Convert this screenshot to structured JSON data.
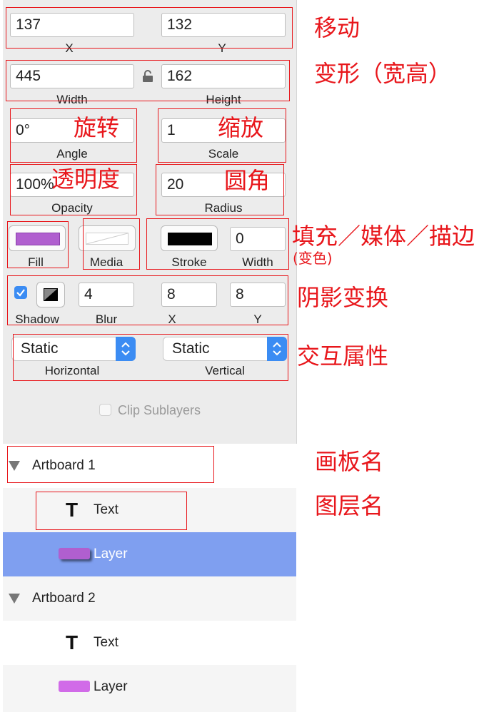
{
  "inspector": {
    "position": {
      "x_value": "137",
      "x_label": "X",
      "y_value": "132",
      "y_label": "Y"
    },
    "size": {
      "width_value": "445",
      "width_label": "Width",
      "height_value": "162",
      "height_label": "Height"
    },
    "rotation": {
      "value": "0°",
      "label": "Angle"
    },
    "scale": {
      "value": "1",
      "label": "Scale"
    },
    "opacity": {
      "value": "100%",
      "label": "Opacity"
    },
    "radius": {
      "value": "20",
      "label": "Radius"
    },
    "fill": {
      "label": "Fill",
      "color": "#b05fcf"
    },
    "media": {
      "label": "Media"
    },
    "stroke": {
      "label": "Stroke",
      "color": "#000000",
      "width_value": "0",
      "width_label": "Width"
    },
    "shadow": {
      "label": "Shadow",
      "checked": true,
      "blur_value": "4",
      "blur_label": "Blur",
      "x_value": "8",
      "x_label": "X",
      "y_value": "8",
      "y_label": "Y"
    },
    "resizing": {
      "horizontal_value": "Static",
      "horizontal_label": "Horizontal",
      "vertical_value": "Static",
      "vertical_label": "Vertical"
    },
    "clip_sublayers": {
      "label": "Clip Sublayers",
      "checked": false
    }
  },
  "layers": [
    {
      "kind": "artboard",
      "name": "Artboard 1"
    },
    {
      "kind": "text",
      "name": "Text"
    },
    {
      "kind": "layer",
      "name": "Layer",
      "selected": true
    },
    {
      "kind": "artboard",
      "name": "Artboard 2"
    },
    {
      "kind": "text",
      "name": "Text"
    },
    {
      "kind": "layer",
      "name": "Layer"
    }
  ],
  "annotations": {
    "move": "移动",
    "transform": "变形（宽高）",
    "rotate": "旋转",
    "scale": "缩放",
    "opacity": "透明度",
    "corner": "圆角",
    "fill_media_stroke": "填充／媒体／描边",
    "color_change": "(变色)",
    "shadow": "阴影变换",
    "interaction": "交互属性",
    "artboard_name": "画板名",
    "layer_name": "图层名"
  },
  "colors": {
    "annotation_red": "#e8161b",
    "selection_blue": "#7f9ff0",
    "checkbox_blue": "#3b8cf3",
    "layer_swatch": "#d16be8"
  }
}
